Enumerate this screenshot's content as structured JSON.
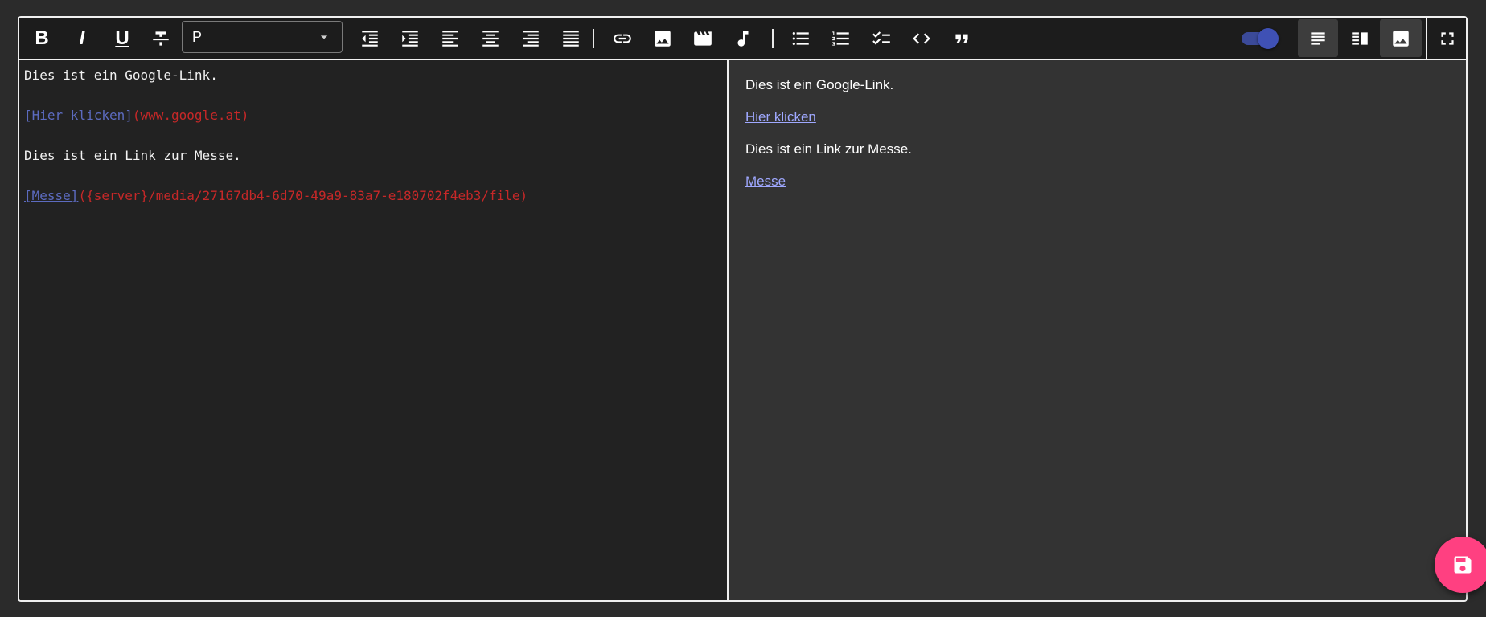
{
  "toolbar": {
    "bold_label": "B",
    "italic_label": "I",
    "underline_label": "U",
    "format_select": {
      "value": "P"
    },
    "icons": [
      "bold-icon",
      "italic-icon",
      "underline-icon",
      "strikethrough-icon",
      "indent-decrease-icon",
      "indent-increase-icon",
      "align-left-icon",
      "align-center-icon",
      "align-right-icon",
      "align-justify-icon",
      "link-icon",
      "image-icon",
      "video-icon",
      "music-icon",
      "bullet-list-icon",
      "numbered-list-icon",
      "checklist-icon",
      "code-icon",
      "quote-icon",
      "view-source-icon",
      "view-split-icon",
      "view-preview-icon",
      "fullscreen-icon"
    ],
    "preview_toggle_on": true
  },
  "source": {
    "line1": "Dies ist ein Google-Link.",
    "link1_text": "[Hier klicken]",
    "link1_url": "(www.google.at)",
    "line3": "Dies ist ein Link zur Messe.",
    "link2_text": "[Messe]",
    "link2_url": "({server}/media/27167db4-6d70-49a9-83a7-e180702f4eb3/file)"
  },
  "preview": {
    "p1": "Dies ist ein Google-Link.",
    "link1": "Hier klicken",
    "p2": "Dies ist ein Link zur Messe.",
    "link2": "Messe"
  },
  "colors": {
    "accent_fab": "#ff4081",
    "toggle": "#3f51b5",
    "md_link_text": "#5c6bc0",
    "md_link_url": "#c62828",
    "preview_link": "#9fa8ff"
  },
  "fab": {
    "icon": "save-icon"
  }
}
